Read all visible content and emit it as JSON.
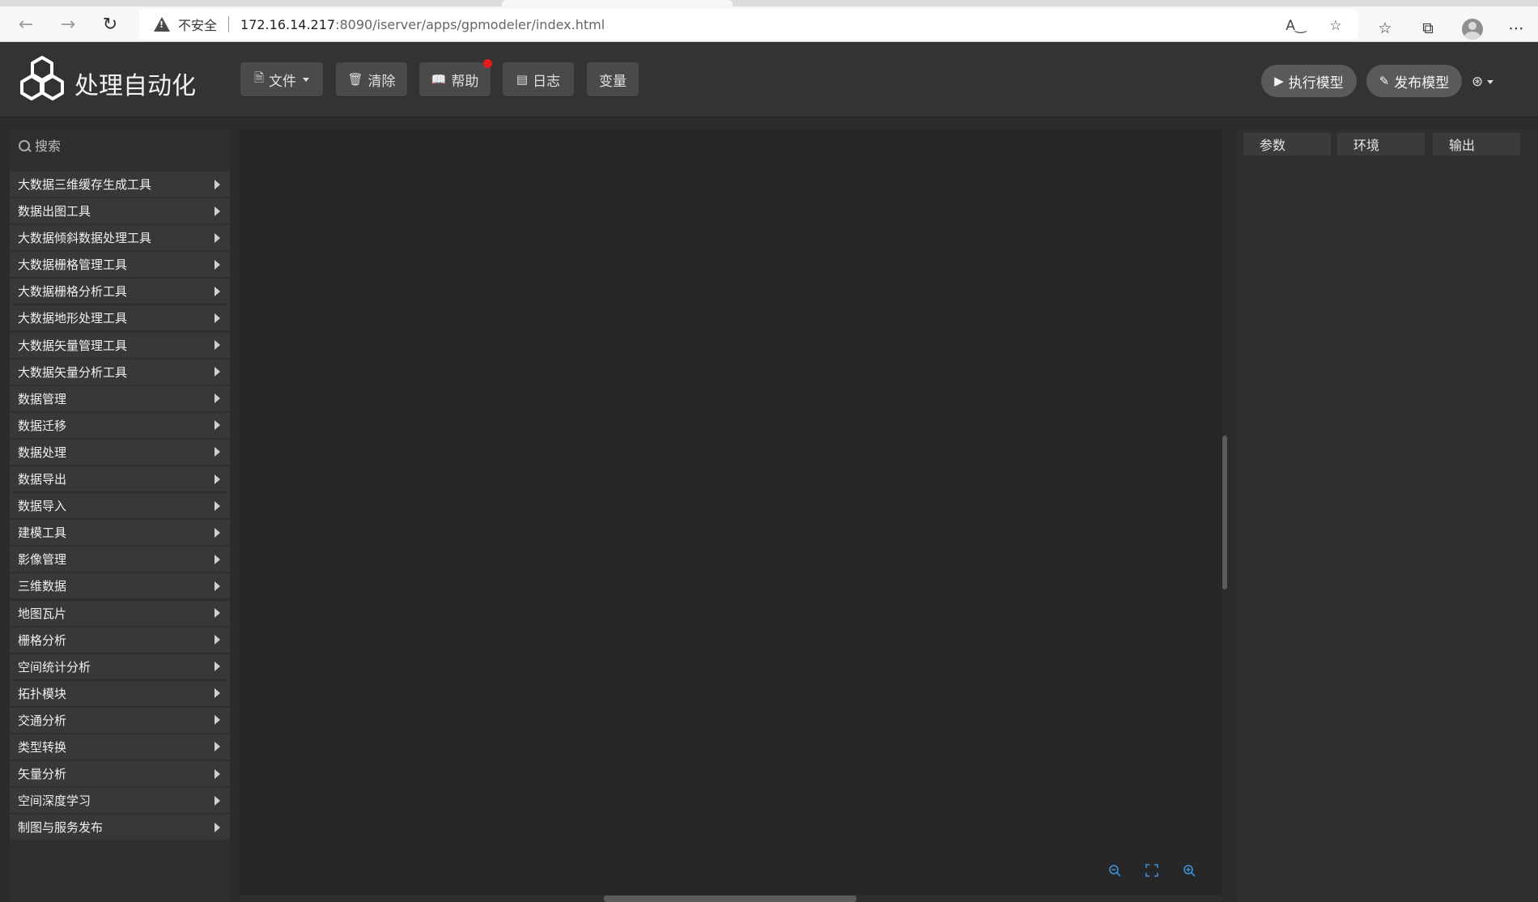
{
  "browser": {
    "security_label": "不安全",
    "url_host": "172.16.14.217",
    "url_rest": ":8090/iserver/apps/gpmodeler/index.html"
  },
  "app": {
    "title": "处理自动化",
    "toolbar": {
      "file_label": "文件",
      "clear_label": "清除",
      "help_label": "帮助",
      "log_label": "日志",
      "variable_label": "变量"
    },
    "actions": {
      "run_label": "执行模型",
      "publish_label": "发布模型"
    }
  },
  "sidebar": {
    "search_placeholder": "搜索",
    "items": [
      "大数据三维缓存生成工具",
      "数据出图工具",
      "大数据倾斜数据处理工具",
      "大数据栅格管理工具",
      "大数据栅格分析工具",
      "大数据地形处理工具",
      "大数据矢量管理工具",
      "大数据矢量分析工具",
      "数据管理",
      "数据迁移",
      "数据处理",
      "数据导出",
      "数据导入",
      "建模工具",
      "影像管理",
      "三维数据",
      "地图瓦片",
      "栅格分析",
      "空间统计分析",
      "拓扑模块",
      "交通分析",
      "类型转换",
      "矢量分析",
      "空间深度学习",
      "制图与服务发布"
    ]
  },
  "right_panel": {
    "tabs": [
      "参数",
      "环境",
      "输出"
    ]
  },
  "colors": {
    "header_bg": "#333333",
    "canvas_bg": "#272727",
    "accent_zoom": "#3d8fd8",
    "notify_dot": "#e11d1d"
  }
}
